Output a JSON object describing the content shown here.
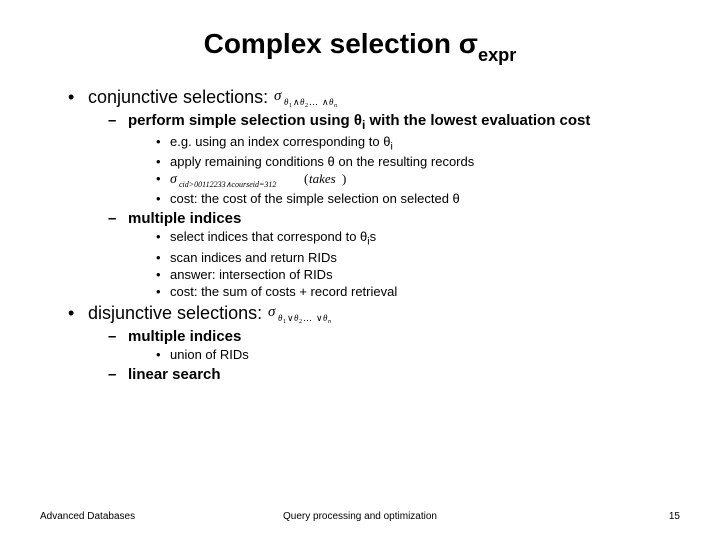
{
  "title_prefix": "Complex selection σ",
  "title_sub": "expr",
  "b1": [
    {
      "label": "conjunctive selections:",
      "formula": "sigma-theta-conj",
      "b2": [
        {
          "label_parts": [
            "perform simple selection using θ",
            "i",
            " with the lowest evaluation cost"
          ],
          "b3": [
            {
              "parts": [
                "e.g. using an index corresponding to θ",
                "i"
              ]
            },
            {
              "parts": [
                "apply remaining conditions θ on the resulting records"
              ]
            },
            {
              "formula": "sigma-cid-course"
            },
            {
              "parts": [
                "cost: the cost of the simple selection on selected θ"
              ]
            }
          ]
        },
        {
          "label_parts": [
            "multiple indices"
          ],
          "b3": [
            {
              "parts": [
                "select indices that correspond to θ",
                "i",
                "s"
              ]
            },
            {
              "parts": [
                "scan indices and return RIDs"
              ]
            },
            {
              "parts": [
                "answer: intersection of RIDs"
              ]
            },
            {
              "parts": [
                "cost: the sum of costs + record retrieval"
              ]
            }
          ]
        }
      ]
    },
    {
      "label": "disjunctive selections:",
      "formula": "sigma-theta-disj",
      "b2": [
        {
          "label_parts": [
            "multiple indices"
          ],
          "b3": [
            {
              "parts": [
                "union of RIDs"
              ]
            }
          ]
        },
        {
          "label_parts": [
            "linear search"
          ],
          "b3": []
        }
      ]
    }
  ],
  "footer": {
    "left": "Advanced Databases",
    "center": "Query processing and optimization",
    "right": "15"
  },
  "formulas": {
    "sigma-theta-conj": {
      "type": "theta-chain",
      "op": "∧"
    },
    "sigma-theta-disj": {
      "type": "theta-chain",
      "op": "∨"
    },
    "sigma-cid-course": {
      "type": "cid-course"
    }
  }
}
